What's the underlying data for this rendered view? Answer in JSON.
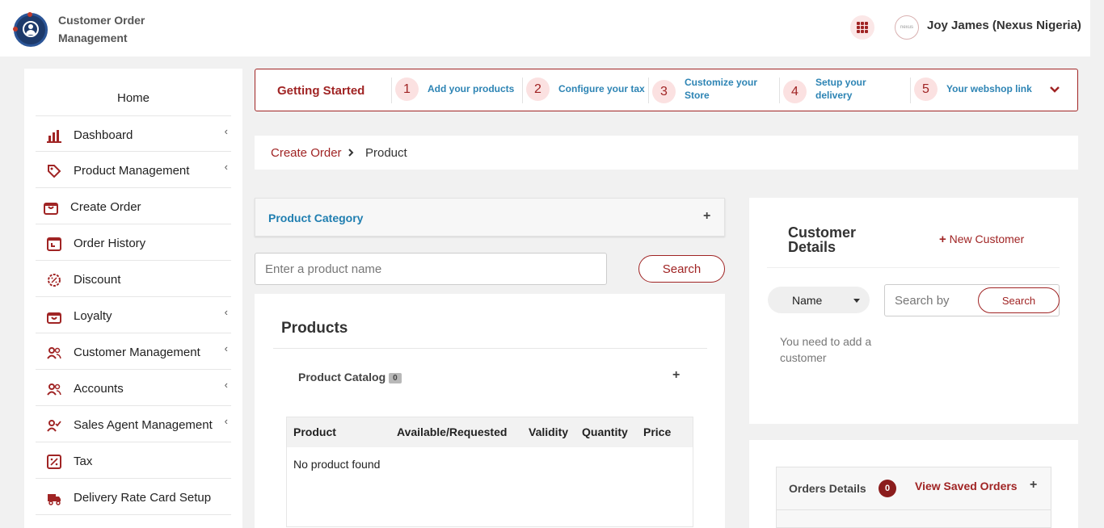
{
  "header": {
    "app_title": "Customer Order Management",
    "user_name": "Joy James (Nexus Nigeria)",
    "avatar_text": "nexus"
  },
  "sidebar": {
    "home": "Home",
    "items": [
      {
        "label": "Dashboard",
        "icon": "bar-chart-icon",
        "has_submenu": true
      },
      {
        "label": "Product Management",
        "icon": "tag-icon",
        "has_submenu": true
      },
      {
        "label": "Create Order",
        "icon": "shopping-bag-icon",
        "has_submenu": false
      },
      {
        "label": "Order History",
        "icon": "history-icon",
        "has_submenu": false
      },
      {
        "label": "Discount",
        "icon": "discount-icon",
        "has_submenu": false
      },
      {
        "label": "Loyalty",
        "icon": "gift-icon",
        "has_submenu": true
      },
      {
        "label": "Customer Management",
        "icon": "users-icon",
        "has_submenu": true
      },
      {
        "label": "Accounts",
        "icon": "users-icon",
        "has_submenu": true
      },
      {
        "label": "Sales Agent Management",
        "icon": "user-check-icon",
        "has_submenu": true
      },
      {
        "label": "Tax",
        "icon": "percent-icon",
        "has_submenu": false
      },
      {
        "label": "Delivery Rate Card Setup",
        "icon": "truck-icon",
        "has_submenu": false
      }
    ],
    "chevron": "‹"
  },
  "getting_started": {
    "title": "Getting Started",
    "steps": [
      {
        "num": "1",
        "label": "Add your products"
      },
      {
        "num": "2",
        "label": "Configure your tax"
      },
      {
        "num": "3",
        "label": "Customize your Store"
      },
      {
        "num": "4",
        "label": "Setup your delivery"
      },
      {
        "num": "5",
        "label": "Your webshop link"
      }
    ]
  },
  "breadcrumb": {
    "parent": "Create Order",
    "current": "Product"
  },
  "product_category": {
    "title": "Product Category",
    "toggle": "+"
  },
  "product_search": {
    "placeholder": "Enter a product name",
    "button": "Search"
  },
  "products": {
    "title": "Products",
    "catalog_title": "Product Catalog",
    "catalog_count": "0",
    "toggle": "+",
    "columns": [
      "Product",
      "Available/Requested",
      "Validity",
      "Quantity",
      "Price"
    ],
    "empty_message": "No product found"
  },
  "customer": {
    "title": "Customer Details",
    "new_customer": "New Customer",
    "search_field": "Name",
    "search_placeholder": "Search by",
    "search_button": "Search",
    "message": "You need to add a customer"
  },
  "orders": {
    "title": "Orders Details",
    "count": "0",
    "view_saved": "View Saved Orders",
    "toggle": "+"
  },
  "colors": {
    "brand": "#a02424",
    "link_blue": "#2d84b4",
    "background": "#f1f1f1"
  }
}
